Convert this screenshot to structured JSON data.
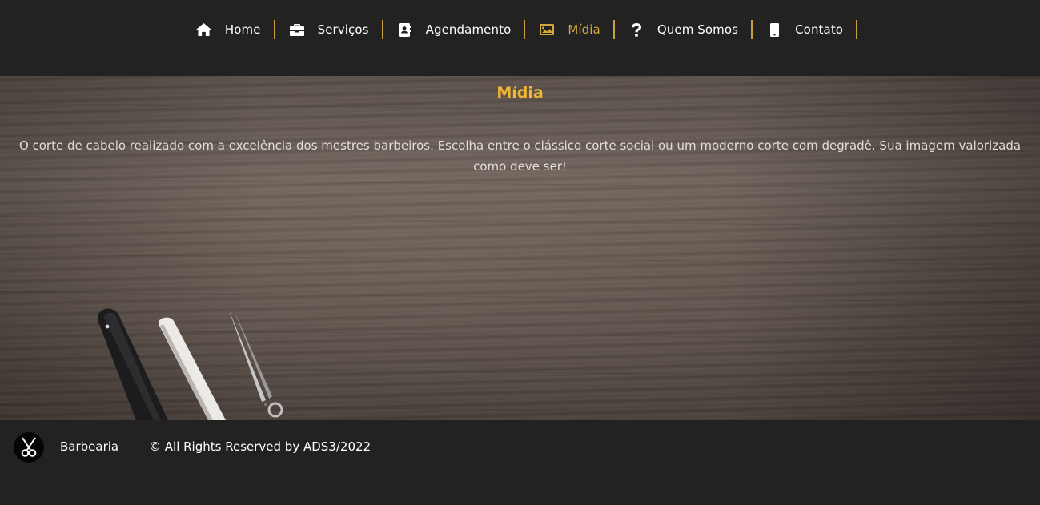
{
  "nav": {
    "items": [
      {
        "label": "Home",
        "icon": "home-icon"
      },
      {
        "label": "Serviços",
        "icon": "briefcase-icon"
      },
      {
        "label": "Agendamento",
        "icon": "address-book-icon"
      },
      {
        "label": "Mídia",
        "icon": "image-icon",
        "active": true
      },
      {
        "label": "Quem Somos",
        "icon": "question-icon"
      },
      {
        "label": "Contato",
        "icon": "mobile-icon"
      }
    ],
    "accent_color": "#c9a23f"
  },
  "hero": {
    "title": "Mídia",
    "text": "O corte de cabelo realizado com a excelência dos mestres barbeiros. Escolha entre o clássico corte social ou um moderno corte com degradê. Sua imagem valorizada como deve ser!",
    "title_color": "#f0b731"
  },
  "footer": {
    "brand": "Barbearia",
    "copyright": "© All Rights Reserved by ADS3/2022",
    "logo_icon": "scissors-icon"
  }
}
